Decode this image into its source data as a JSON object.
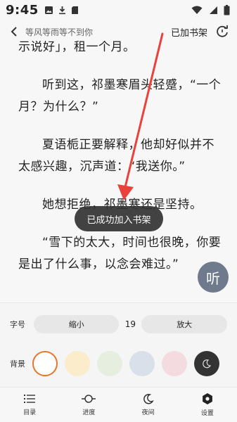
{
  "status_bar": {
    "time": "9:45"
  },
  "top_bar": {
    "title": "等风等雨等不到你",
    "add_shelf": "已加书架"
  },
  "content": {
    "paragraphs": [
      "示说好」，租一个月。",
      "听到这，祁墨寒眉头轻蹙，“一个月？为什么？”",
      "夏语栀正要解释，他却好似并不太感兴趣，沉声道：“我送你。”",
      "她想拒绝，祁墨寒还是坚持。",
      "“雪下的太大，时间也很晚，你要是出了什么事，以念会难过。”"
    ]
  },
  "toast": {
    "text": "已成功加入书架"
  },
  "listen_button": {
    "label": "听"
  },
  "settings_panel": {
    "font_label": "字号",
    "decrease_label": "缩小",
    "font_size": "19",
    "increase_label": "放大",
    "bg_label": "背景",
    "swatches": [
      {
        "name": "white",
        "color": "#ffffff",
        "selected": true
      },
      {
        "name": "yellow",
        "color": "#fbeccb"
      },
      {
        "name": "green",
        "color": "#e6efdf"
      },
      {
        "name": "blue",
        "color": "#d9e0ea"
      },
      {
        "name": "pink",
        "color": "#f3dbe0"
      },
      {
        "name": "night",
        "color": "#333333"
      }
    ]
  },
  "bottom_nav": {
    "items": [
      {
        "label": "目录",
        "icon": "list-icon"
      },
      {
        "label": "进度",
        "icon": "progress-icon"
      },
      {
        "label": "夜间",
        "icon": "moon-icon"
      },
      {
        "label": "设置",
        "icon": "gear-icon"
      }
    ]
  },
  "colors": {
    "accent": "#e8752a",
    "arrow": "#e8423a"
  }
}
